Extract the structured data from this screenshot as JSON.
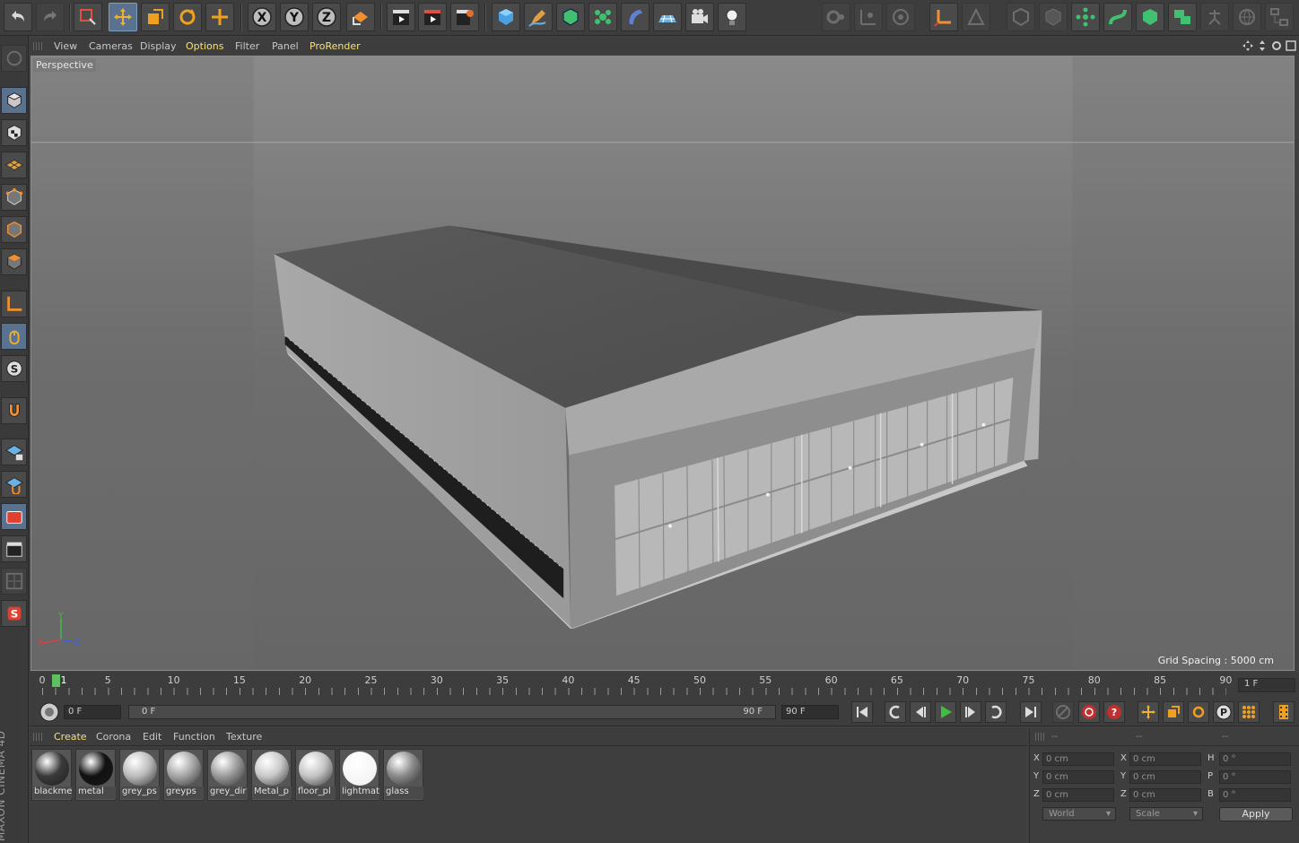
{
  "viewport_menu": [
    "View",
    "Cameras",
    "Display",
    "Options",
    "Filter",
    "Panel",
    "ProRender"
  ],
  "viewport": {
    "camera_label": "Perspective",
    "grid_spacing": "Grid Spacing : 5000 cm",
    "axis_labels": {
      "x": "X",
      "y": "Y",
      "z": "Z"
    }
  },
  "toolbar_axis": {
    "x": "X",
    "y": "Y",
    "z": "Z"
  },
  "timeline": {
    "ticks": [
      "0",
      "5",
      "10",
      "15",
      "20",
      "25",
      "30",
      "35",
      "40",
      "45",
      "50",
      "55",
      "60",
      "65",
      "70",
      "75",
      "80",
      "85",
      "90"
    ],
    "marker_label": "1",
    "frame_field": "1 F"
  },
  "transport": {
    "current_frame": "0 F",
    "slider_start": "0 F",
    "slider_end": "90 F",
    "end_frame": "90 F"
  },
  "material_menu": [
    "Create",
    "Corona",
    "Edit",
    "Function",
    "Texture"
  ],
  "materials": [
    {
      "name": "blackme",
      "color": "#3a3a3a"
    },
    {
      "name": "metal",
      "color": "#111111"
    },
    {
      "name": "grey_ps",
      "color": "#bdbdbd"
    },
    {
      "name": "greyps",
      "color": "#a6a6a6"
    },
    {
      "name": "grey_dir",
      "color": "#9b9b9b"
    },
    {
      "name": "Metal_p",
      "color": "#c9c9c9"
    },
    {
      "name": "floor_pl",
      "color": "#c4c4c4"
    },
    {
      "name": "lightmat",
      "color": "#ffffff"
    },
    {
      "name": "glass",
      "color": "#8a8a8a"
    }
  ],
  "coordinates": {
    "header": [
      "--",
      "--",
      "--"
    ],
    "rows": [
      {
        "l1": "X",
        "v1": "0 cm",
        "l2": "X",
        "v2": "0 cm",
        "l3": "H",
        "v3": "0 °"
      },
      {
        "l1": "Y",
        "v1": "0 cm",
        "l2": "Y",
        "v2": "0 cm",
        "l3": "P",
        "v3": "0 °"
      },
      {
        "l1": "Z",
        "v1": "0 cm",
        "l2": "Z",
        "v2": "0 cm",
        "l3": "B",
        "v3": "0 °"
      }
    ],
    "mode": "World",
    "size_mode": "Scale",
    "apply": "Apply"
  },
  "brand": "MAXON CINEMA 4D",
  "colors": {
    "accent": "#5a7290",
    "highlight_text": "#f6e07a",
    "play_green": "#3fbf3f"
  }
}
